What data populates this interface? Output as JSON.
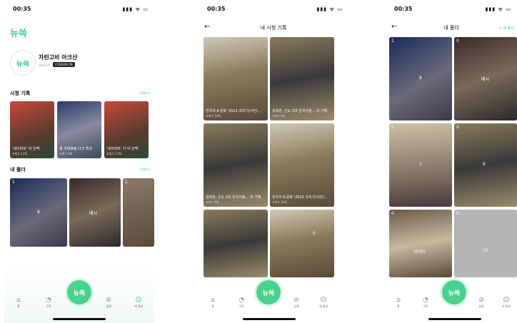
{
  "status": {
    "time": "00:35",
    "icons": "▮▮▮ ᯤ ▭"
  },
  "app": {
    "logo": "뉴쓱"
  },
  "screen1": {
    "profile": {
      "name": "자린고비 아크샨",
      "sub": "@자린고",
      "chip": "COSSON ON"
    },
    "history": {
      "title": "시청 기록",
      "more": "전체보기",
      "cards": [
        {
          "caption": "'네이마르' 의 인맥",
          "views": "조회수 17회"
        },
        {
          "caption": "호 구대표팀 다크 백성",
          "views": "조회수 9회"
        },
        {
          "caption": "'네이마르' 가 이 인맥",
          "views": "조회수 17회"
        }
      ]
    },
    "folders": {
      "title": "내 폴더",
      "more": "전체보기",
      "cards": [
        {
          "count": "1",
          "label": "8"
        },
        {
          "count": "",
          "label": "메시"
        },
        {
          "count": "1",
          "label": ""
        }
      ]
    }
  },
  "screen2": {
    "title": "내 시청 기록",
    "cards": [
      {
        "caption": "한국의 K-문화 '2022 조직기/사진/...",
        "views": "조회수 10회"
      },
      {
        "caption": "김희완, 신도 2대 한국서울... 의 가해",
        "views": "조회수 9회"
      },
      {
        "caption": "김희완, 신도 2대 한국서울... 의 가해",
        "views": "조회수 9회"
      },
      {
        "caption": "한국의 K-문화 '2022 조직기/사진/...",
        "views": "조회수 10회"
      },
      {
        "caption": "",
        "views": ""
      },
      {
        "caption": "",
        "views": "0"
      }
    ]
  },
  "screen3": {
    "title": "내 폴더",
    "action": "+ 새 폴더",
    "cards": [
      {
        "count": "1",
        "label": "8"
      },
      {
        "count": "0",
        "label": "메시"
      },
      {
        "count": "1",
        "label": "1"
      },
      {
        "count": "0",
        "label": "6"
      },
      {
        "count": "0",
        "label": "귀미반"
      },
      {
        "count": "0",
        "label": "10"
      }
    ]
  },
  "tabs": [
    {
      "icon": "⌂",
      "label": "홈"
    },
    {
      "icon": "◔",
      "label": "구독"
    },
    {
      "icon": "⊘",
      "label": "검색"
    },
    {
      "icon": "☺",
      "label": "내 정보"
    }
  ]
}
